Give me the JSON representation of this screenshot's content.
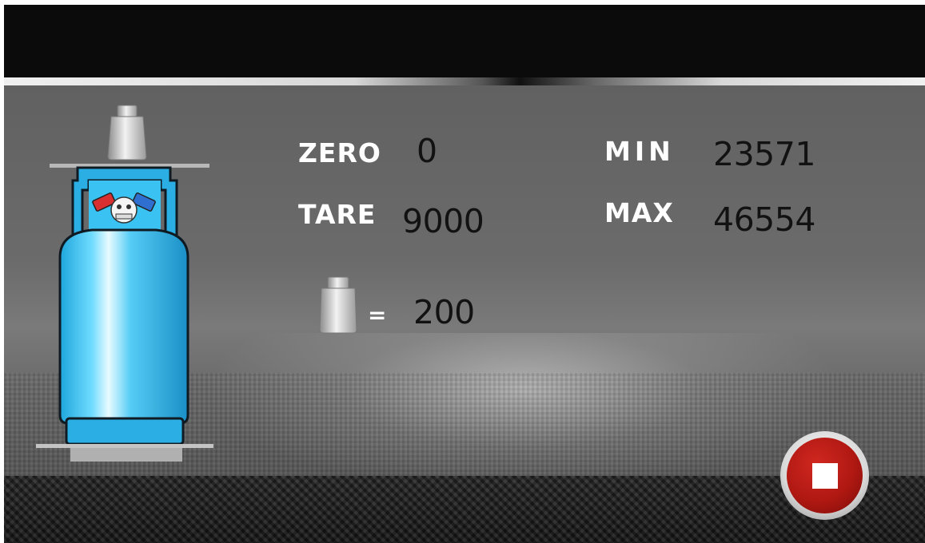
{
  "readings": {
    "zero": {
      "label": "ZERO",
      "value": "0"
    },
    "tare": {
      "label": "TARE",
      "value": "9000"
    },
    "min": {
      "label": "MIN",
      "value": "23571"
    },
    "max": {
      "label": "MAX",
      "value": "46554"
    }
  },
  "weight": {
    "equals": "=",
    "value": "200"
  },
  "controls": {
    "stop_icon": "stop-icon"
  },
  "colors": {
    "cylinder": "#3fc6f0",
    "cylinder_dark": "#1a96cc",
    "stop_red": "#c0201a",
    "valve_red": "#d83030",
    "valve_blue": "#2f6fd0"
  }
}
